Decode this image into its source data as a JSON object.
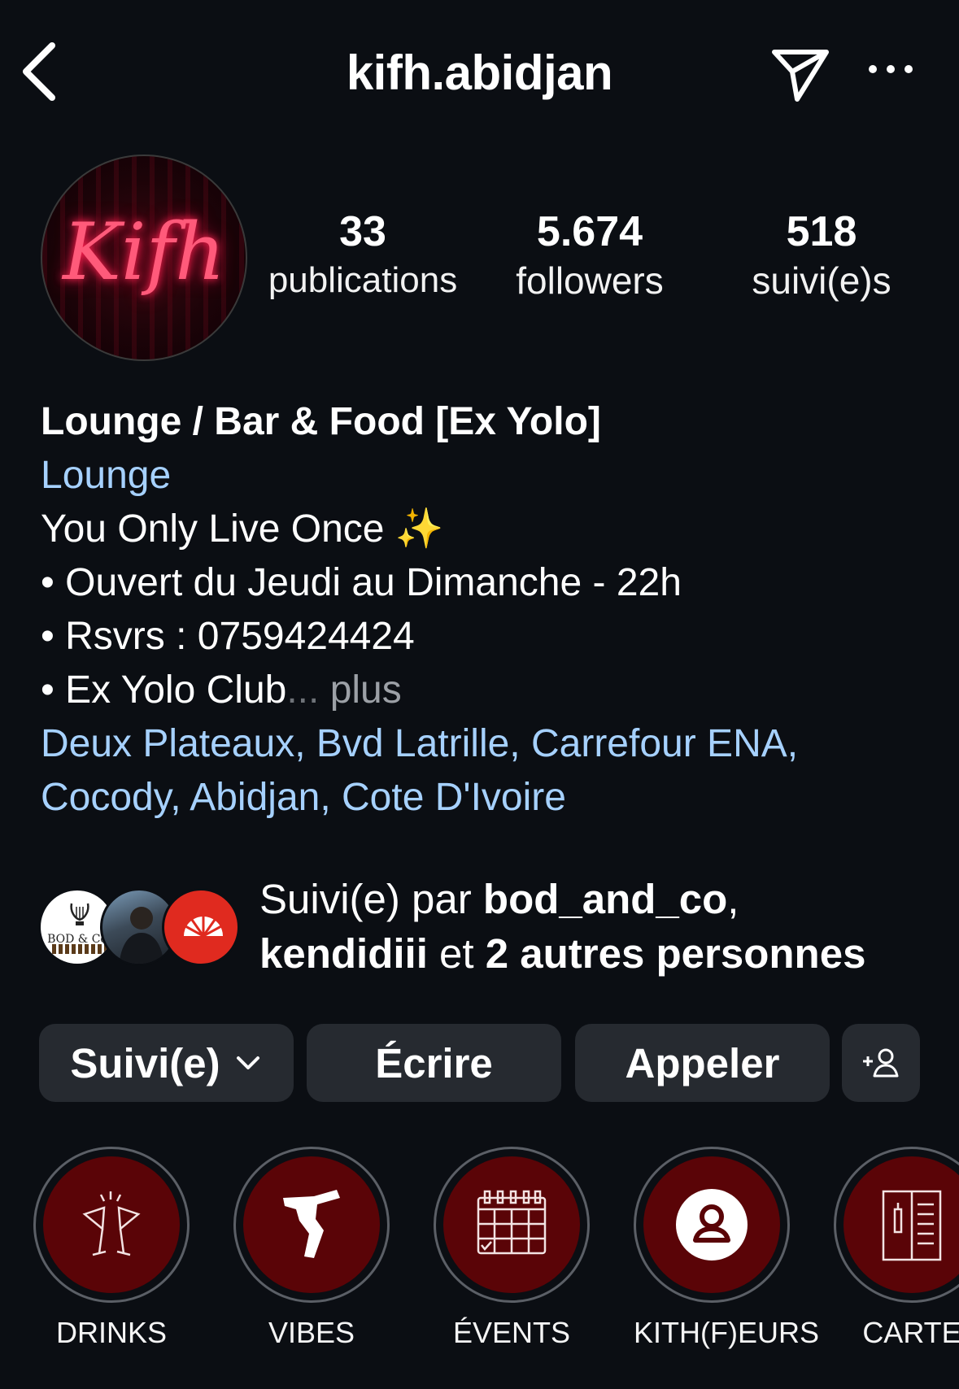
{
  "header": {
    "title": "kifh.abidjan",
    "back_icon": "chevron-left-icon",
    "send_icon": "paper-plane-icon",
    "more_icon": "more-horizontal-icon"
  },
  "profile": {
    "avatar_text": "Kifh",
    "stats": {
      "publications": {
        "value": "33",
        "label": "publications"
      },
      "followers": {
        "value": "5.674",
        "label": "followers"
      },
      "following": {
        "value": "518",
        "label": "suivi(e)s"
      }
    }
  },
  "bio": {
    "name": "Lounge / Bar & Food [Ex Yolo]",
    "category": "Lounge",
    "line1": "You Only Live Once ✨",
    "line2": "• Ouvert du Jeudi au Dimanche - 22h",
    "line3": "• Rsvrs : 0759424424",
    "line4": "• Ex Yolo Club",
    "ellipsis": "...",
    "more": " plus",
    "address1": "Deux Plateaux, Bvd Latrille, Carrefour ENA,",
    "address2": "Cocody, Abidjan, Cote D'Ivoire"
  },
  "followed_by": {
    "prefix": "Suivi(e) par ",
    "user1": "bod_and_co",
    "sep": ",",
    "user2": "kendidiii",
    "conj": " et ",
    "others": "2 autres personnes",
    "bod_avatar_text": "BOD & Co"
  },
  "buttons": {
    "follow": "Suivi(e)",
    "write": "Écrire",
    "call": "Appeler",
    "add_user_icon": "add-user-icon"
  },
  "highlights": [
    {
      "label": "DRINKS",
      "icon": "cheers-glasses-icon"
    },
    {
      "label": "VIBES",
      "icon": "breakdancer-icon"
    },
    {
      "label": "ÉVENTS",
      "icon": "calendar-icon"
    },
    {
      "label": "KITH(F)EURS",
      "icon": "person-icon"
    },
    {
      "label": "CARTE",
      "icon": "menu-card-icon"
    }
  ],
  "colors": {
    "background": "#0b0e13",
    "link": "#a6d1ff",
    "button": "#262a30",
    "highlight_bg": "#5a0407"
  }
}
